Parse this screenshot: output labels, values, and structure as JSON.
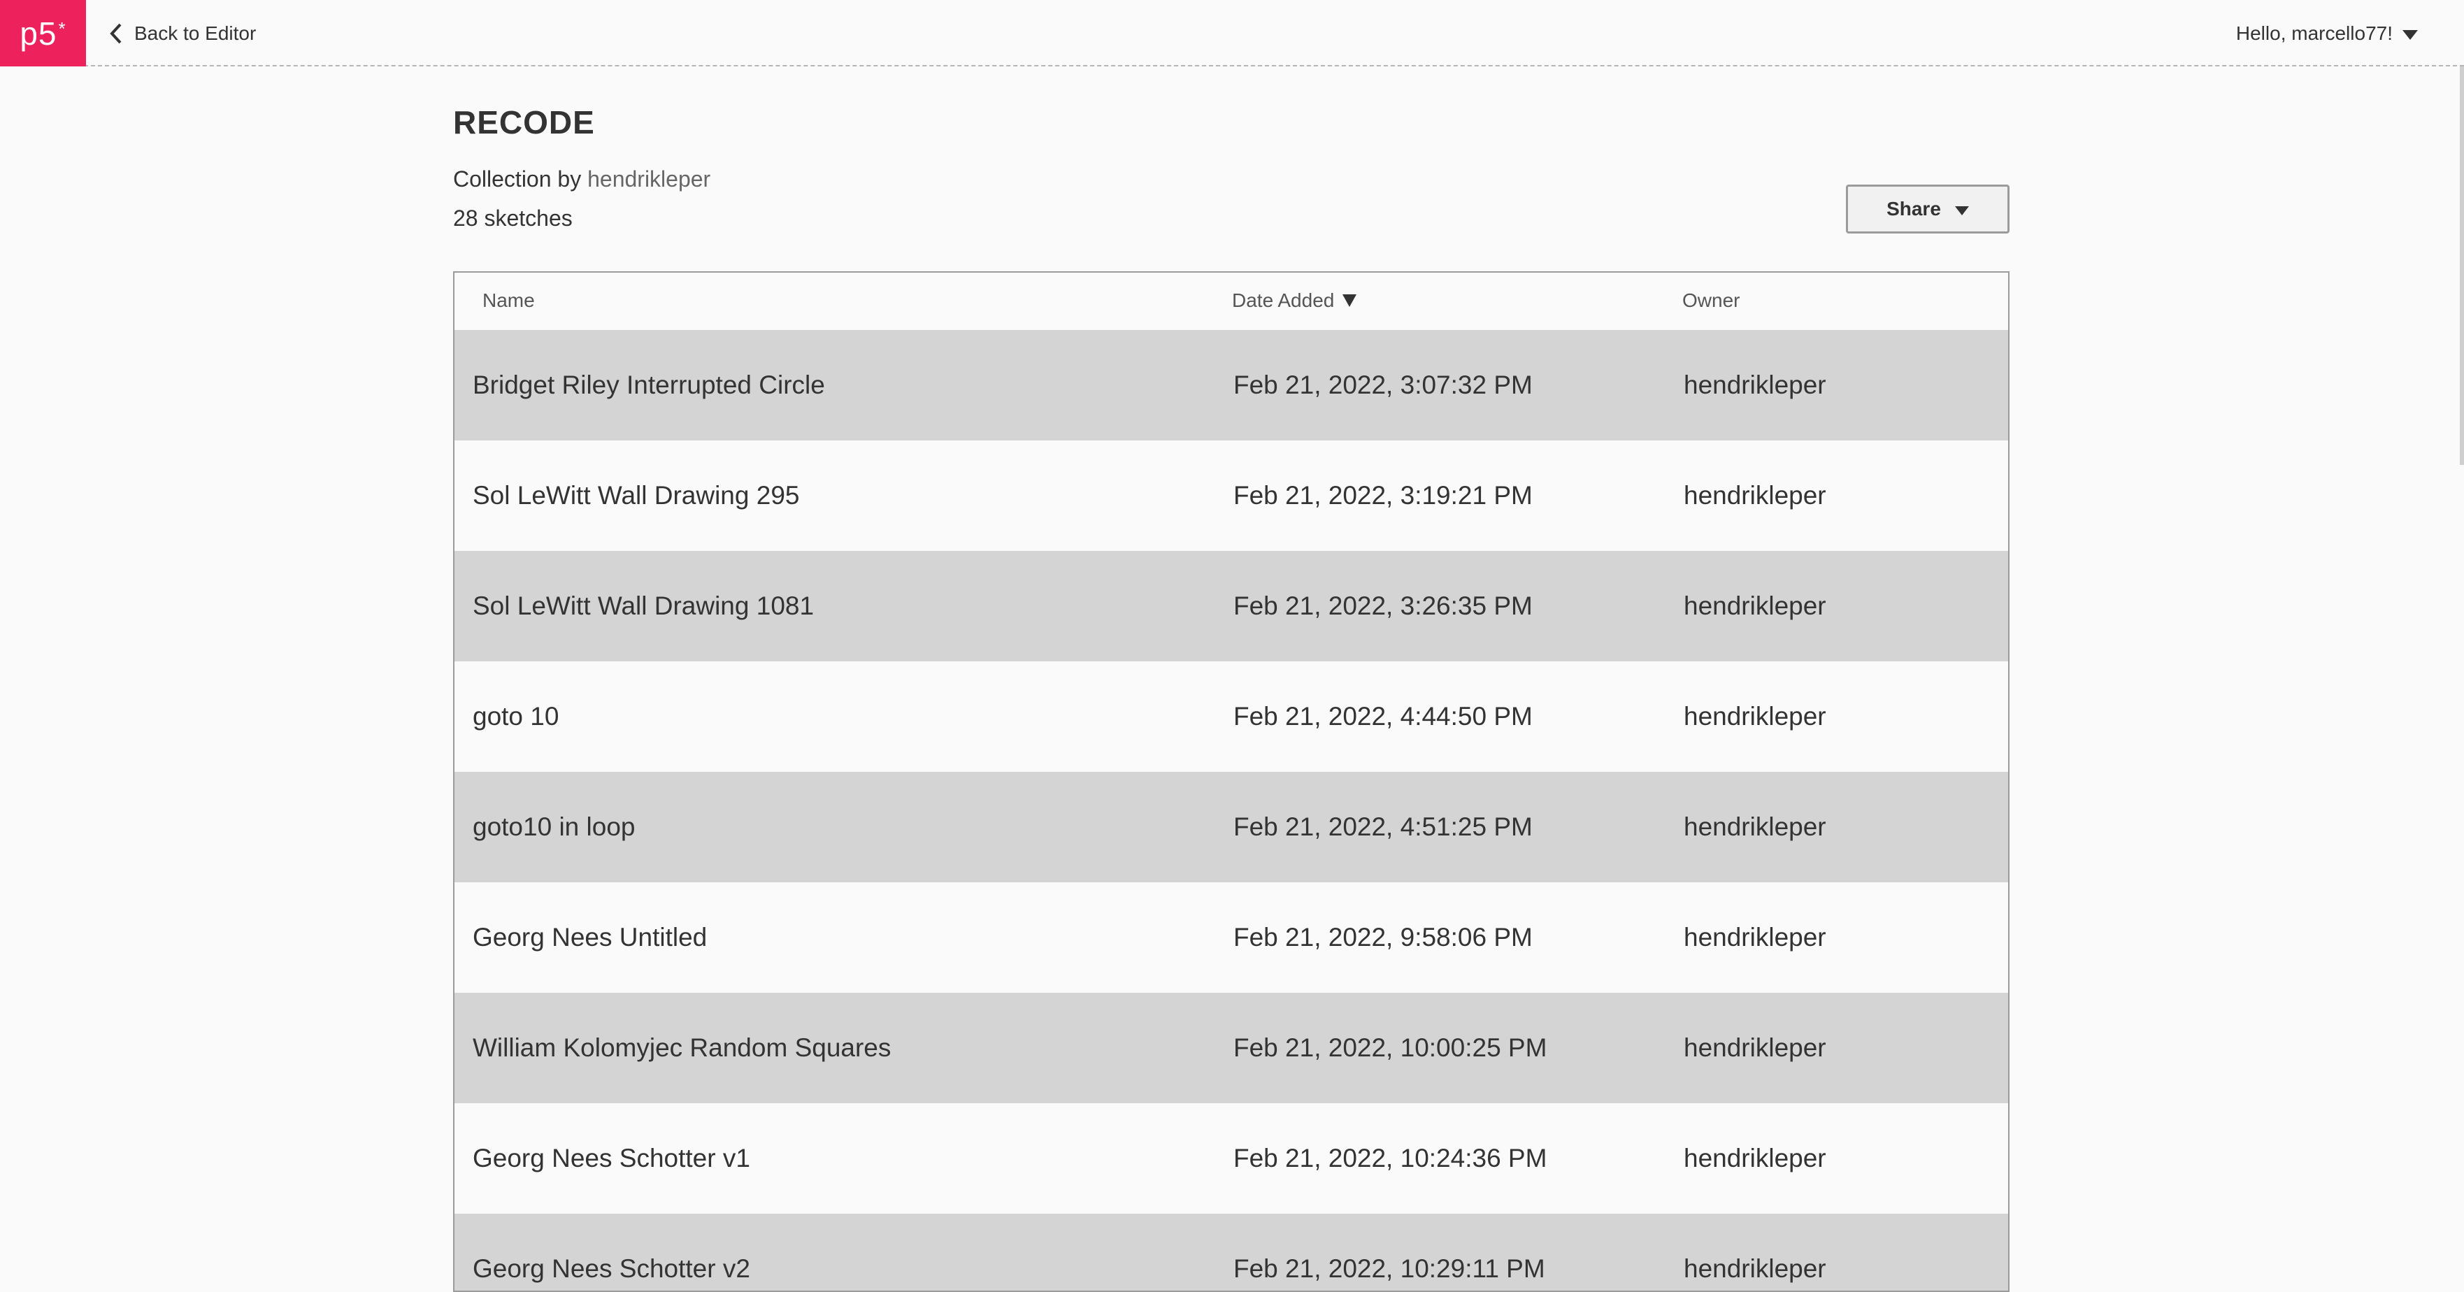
{
  "nav": {
    "logo_text": "p5",
    "logo_star": "*",
    "back_label": "Back to Editor",
    "user_greeting": "Hello, marcello77!"
  },
  "collection": {
    "title": "RECODE",
    "byline_prefix": "Collection by",
    "owner": "hendrikleper",
    "count_label": "28 sketches",
    "share_label": "Share"
  },
  "table": {
    "headers": {
      "name": "Name",
      "date": "Date Added",
      "owner": "Owner"
    },
    "sort_indicator": "descending",
    "rows": [
      {
        "name": "Bridget Riley Interrupted Circle",
        "date": "Feb 21, 2022, 3:07:32 PM",
        "owner": "hendrikleper"
      },
      {
        "name": "Sol LeWitt Wall Drawing 295",
        "date": "Feb 21, 2022, 3:19:21 PM",
        "owner": "hendrikleper"
      },
      {
        "name": "Sol LeWitt Wall Drawing 1081",
        "date": "Feb 21, 2022, 3:26:35 PM",
        "owner": "hendrikleper"
      },
      {
        "name": "goto 10",
        "date": "Feb 21, 2022, 4:44:50 PM",
        "owner": "hendrikleper"
      },
      {
        "name": "goto10 in loop",
        "date": "Feb 21, 2022, 4:51:25 PM",
        "owner": "hendrikleper"
      },
      {
        "name": "Georg Nees Untitled",
        "date": "Feb 21, 2022, 9:58:06 PM",
        "owner": "hendrikleper"
      },
      {
        "name": "William Kolomyjec Random Squares",
        "date": "Feb 21, 2022, 10:00:25 PM",
        "owner": "hendrikleper"
      },
      {
        "name": "Georg Nees Schotter v1",
        "date": "Feb 21, 2022, 10:24:36 PM",
        "owner": "hendrikleper"
      },
      {
        "name": "Georg Nees Schotter v2",
        "date": "Feb 21, 2022, 10:29:11 PM",
        "owner": "hendrikleper"
      }
    ]
  },
  "colors": {
    "brand": "#ed225d",
    "row_alt": "#d4d4d4",
    "background": "#fafafa"
  }
}
